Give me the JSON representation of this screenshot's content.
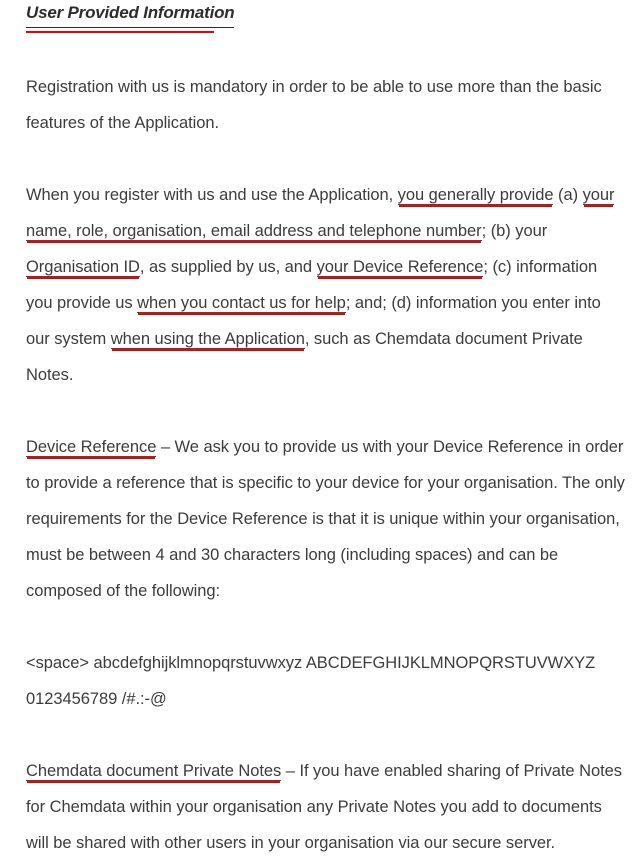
{
  "document": {
    "heading": "User Provided Information",
    "accent_color": "#ee0000",
    "text_color": "#3c3c3c",
    "background_color": "#ffffff",
    "paragraphs": [
      {
        "id": "registration-mandatory",
        "segments": [
          {
            "text": "Registration with us is mandatory in order to be able to use more than the basic features of the Application.",
            "underlined": false
          }
        ]
      },
      {
        "id": "information-you-provide",
        "segments": [
          {
            "text": "When you register with us and use the Application, ",
            "underlined": false
          },
          {
            "text": "you generally provide",
            "underlined": true
          },
          {
            "text": " (a) ",
            "underlined": false
          },
          {
            "text": "your name, role, organisation, email address and telephone number",
            "underlined": true
          },
          {
            "text": "; (b) your ",
            "underlined": false
          },
          {
            "text": "Organisation ID",
            "underlined": true
          },
          {
            "text": ", as supplied by us, and ",
            "underlined": false
          },
          {
            "text": "your Device Reference",
            "underlined": true
          },
          {
            "text": "; (c) information you provide us ",
            "underlined": false
          },
          {
            "text": "when you contact us for help",
            "underlined": true
          },
          {
            "text": "; and; (d) information you enter into our system ",
            "underlined": false
          },
          {
            "text": "when using the Application",
            "underlined": true
          },
          {
            "text": ", such as Chemdata document Private Notes.",
            "underlined": false
          }
        ]
      },
      {
        "id": "device-reference",
        "segments": [
          {
            "text": "Device Reference",
            "underlined": true
          },
          {
            "text": " – We ask you to provide us with your Device Reference in order to provide a reference that is specific to your device for your organisation. The only requirements for the Device Reference is that it is unique within your organisation, must be between 4 and 30 characters long (including spaces) and can be composed of the following:",
            "underlined": false
          }
        ]
      },
      {
        "id": "allowed-characters",
        "segments": [
          {
            "text": "<space> abcdefghijklmnopqrstuvwxyz ABCDEFGHIJKLMNOPQRSTUVWXYZ 0123456789 /#.:-@",
            "underlined": false
          }
        ]
      },
      {
        "id": "private-notes",
        "segments": [
          {
            "text": "Chemdata document Private Notes",
            "underlined": true
          },
          {
            "text": " – If you have enabled sharing of Private Notes for Chemdata within your organisation any Private Notes you add to documents will be shared with other users in your organisation via our secure server.",
            "underlined": false
          }
        ]
      }
    ]
  }
}
